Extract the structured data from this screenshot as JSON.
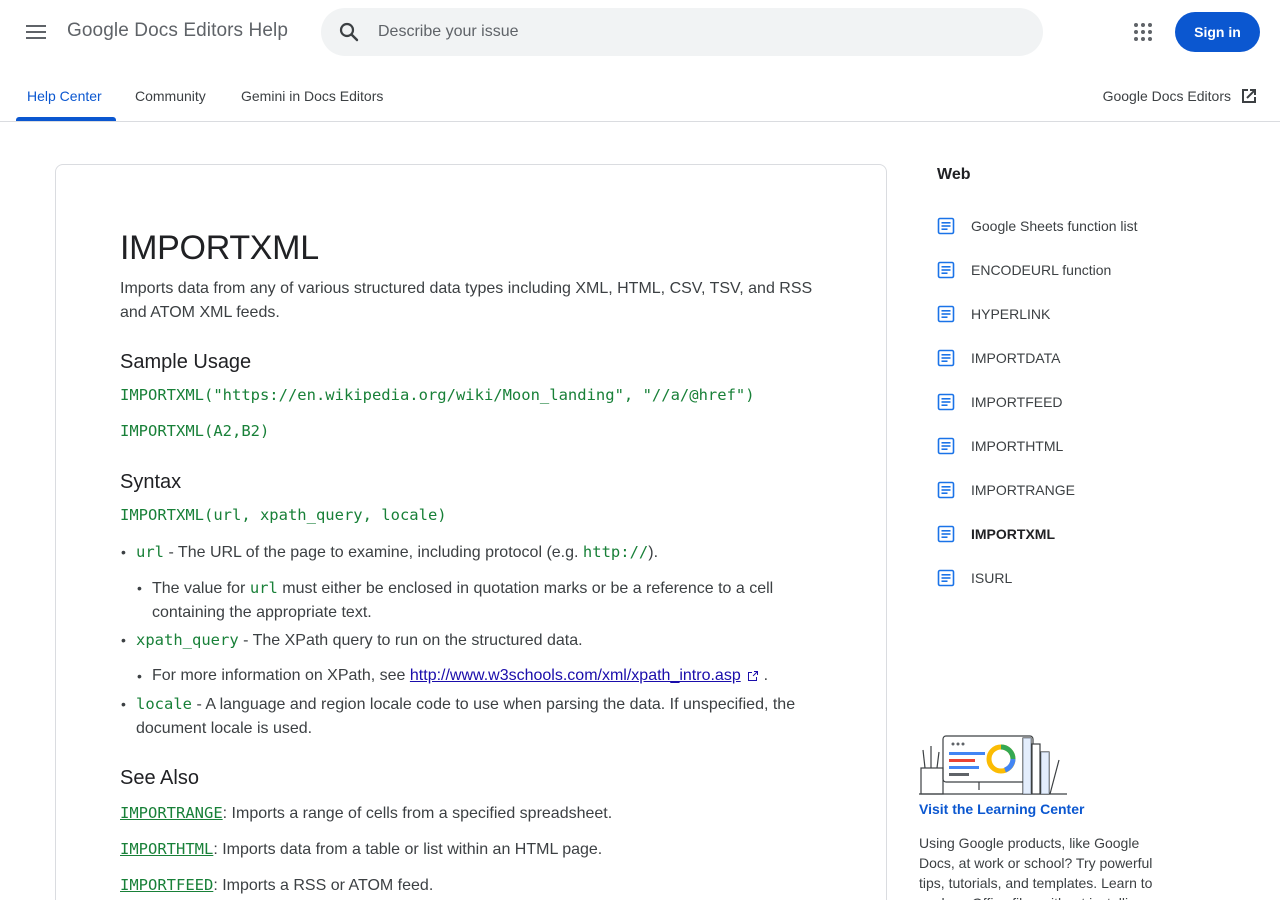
{
  "header": {
    "app_title": "Google Docs Editors Help",
    "search_placeholder": "Describe your issue",
    "sign_in": "Sign in"
  },
  "tabs": [
    {
      "label": "Help Center",
      "active": true
    },
    {
      "label": "Community",
      "active": false
    },
    {
      "label": "Gemini in Docs Editors",
      "active": false
    }
  ],
  "external_link": "Google Docs Editors",
  "article": {
    "title": "IMPORTXML",
    "intro": "Imports data from any of various structured data types including XML, HTML, CSV, TSV, and RSS and ATOM XML feeds.",
    "sample_heading": "Sample Usage",
    "sample_1": "IMPORTXML(\"https://en.wikipedia.org/wiki/Moon_landing\", \"//a/@href\")",
    "sample_2": "IMPORTXML(A2,B2)",
    "syntax_heading": "Syntax",
    "syntax": "IMPORTXML(url, xpath_query, locale)",
    "params": {
      "url_code": "url",
      "url_desc": " - The URL of the page to examine, including protocol (e.g. ",
      "url_example": "http://",
      "url_desc_end": ").",
      "url_sub_a": "The value for ",
      "url_sub_code": "url",
      "url_sub_b": " must either be enclosed in quotation marks or be a reference to a cell containing the appropriate text.",
      "xpath_code": "xpath_query",
      "xpath_desc": " - The XPath query to run on the structured data.",
      "xpath_sub_a": "For more information on XPath, see ",
      "xpath_sub_link": "http://www.w3schools.com/xml/xpath_intro.asp",
      "xpath_sub_end": ".",
      "locale_code": "locale",
      "locale_desc": " - A language and region locale code to use when parsing the data. If unspecified, the document locale is used."
    },
    "see_also_heading": "See Also",
    "see_also": [
      {
        "fn": "IMPORTRANGE",
        "desc": ": Imports a range of cells from a specified spreadsheet."
      },
      {
        "fn": "IMPORTHTML",
        "desc": ": Imports data from a table or list within an HTML page."
      },
      {
        "fn": "IMPORTFEED",
        "desc": ": Imports a RSS or ATOM feed."
      }
    ]
  },
  "sidebar": {
    "heading": "Web",
    "items": [
      "Google Sheets function list",
      "ENCODEURL function",
      "HYPERLINK",
      "IMPORTDATA",
      "IMPORTFEED",
      "IMPORTHTML",
      "IMPORTRANGE",
      "IMPORTXML",
      "ISURL"
    ],
    "current_item": "IMPORTXML"
  },
  "learning_center": {
    "title": "Visit the Learning Center",
    "text": "Using Google products, like Google Docs, at work or school? Try powerful tips, tutorials, and templates. Learn to work on Office files without installing Office."
  },
  "colors": {
    "accent": "#0b57d0",
    "code": "#188038",
    "link": "#1a0dab"
  }
}
